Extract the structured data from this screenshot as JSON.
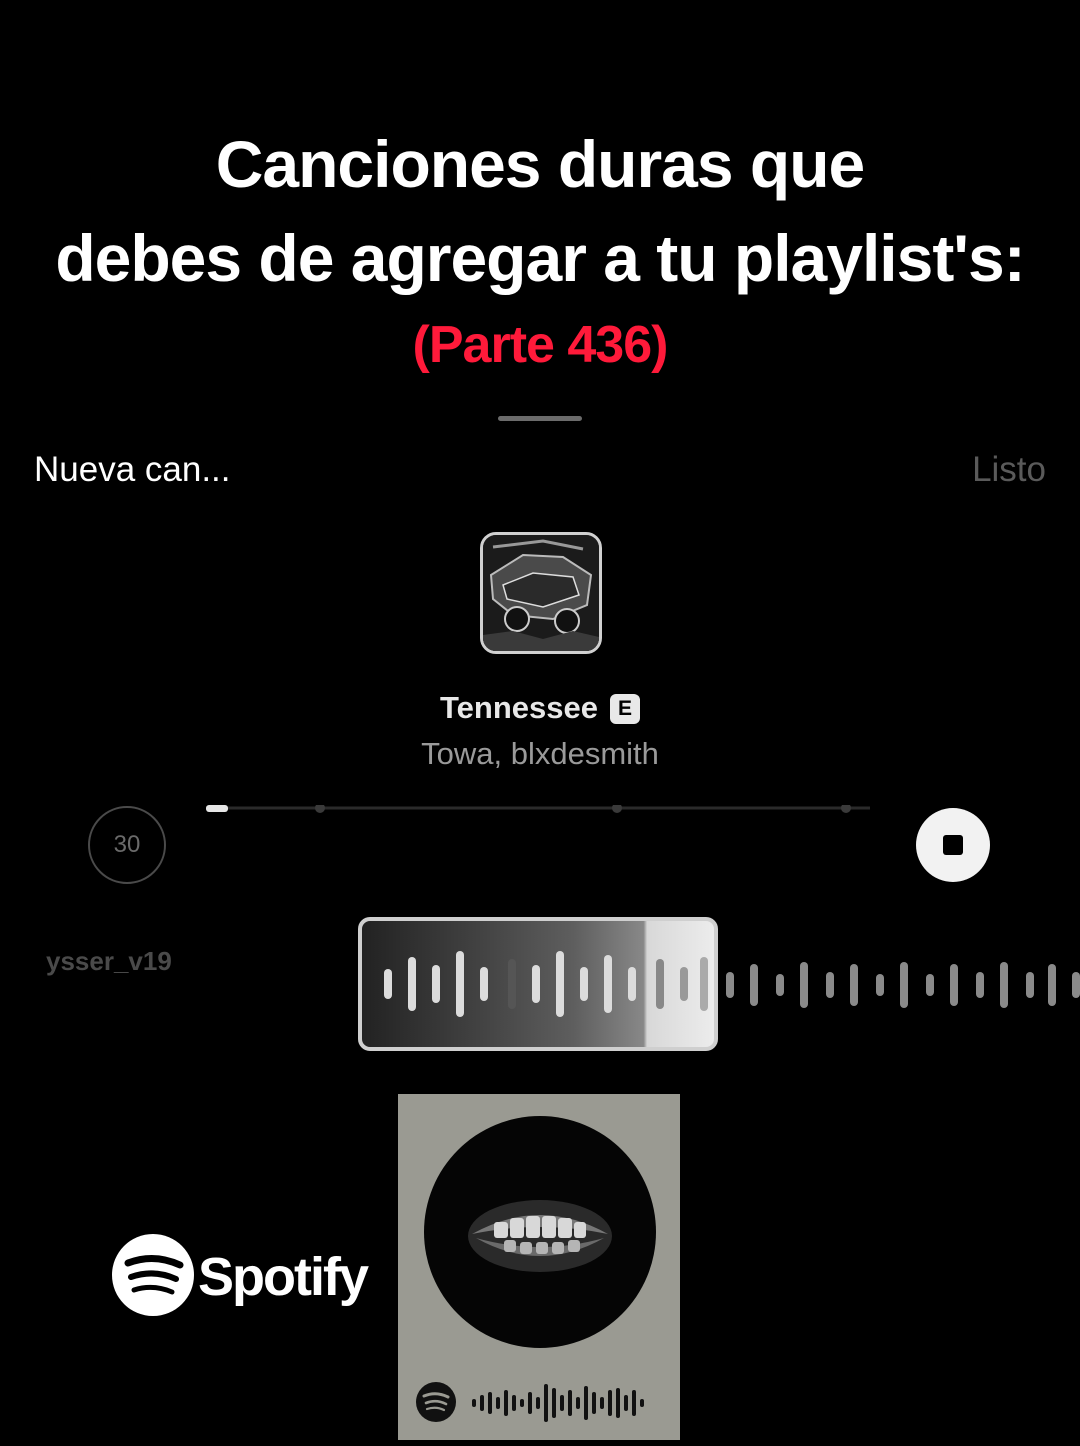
{
  "overlay": {
    "title_line1": "Canciones duras que",
    "title_line2": "debes de agregar a tu playlist's:",
    "part_label": "(Parte 436)",
    "part_color": "#ff1a3a"
  },
  "sheet": {
    "left_label": "Nueva can...",
    "right_label": "Listo"
  },
  "song": {
    "title": "Tennessee",
    "explicit_badge": "E",
    "artist": "Towa, blxdesmith"
  },
  "player": {
    "duration_label": "30",
    "progress": 0.02,
    "username": "ysser_v19"
  },
  "branding": {
    "spotify_word": "Spotify"
  },
  "icons": [
    "stop-icon",
    "spotify-logo-icon",
    "explicit-icon"
  ]
}
